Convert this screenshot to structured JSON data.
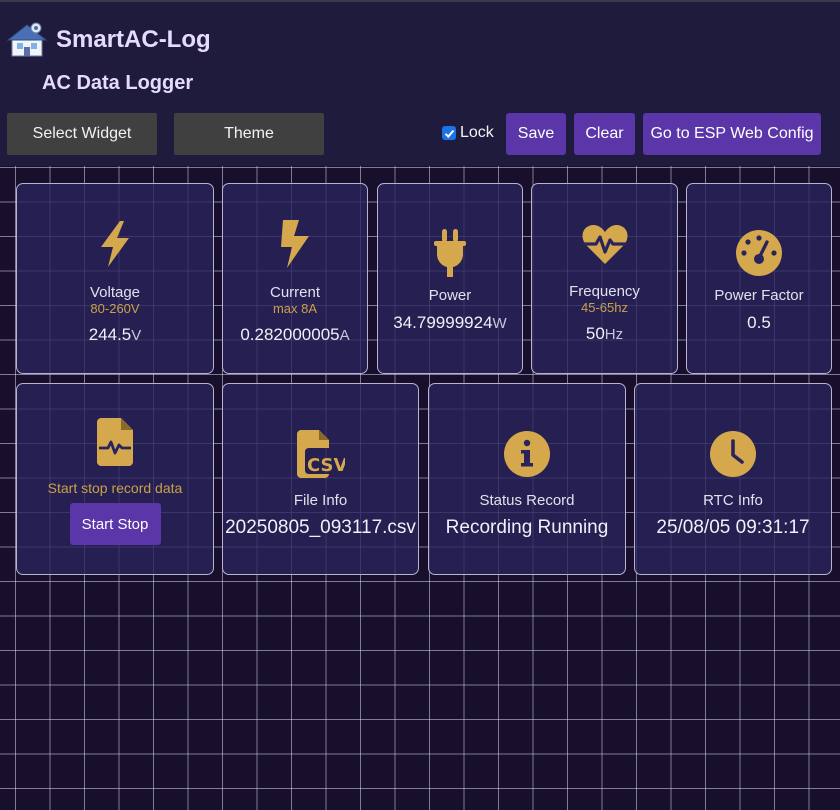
{
  "header": {
    "title": "SmartAC-Log",
    "subtitle": "AC Data Logger"
  },
  "toolbar": {
    "select_widget_label": "Select Widget",
    "theme_label": "Theme",
    "lock_label": "Lock",
    "lock_checked": true,
    "save_label": "Save",
    "clear_label": "Clear",
    "esp_config_label": "Go to ESP Web Config"
  },
  "colors": {
    "background": "#170f2c",
    "header_background": "#1f1b3d",
    "accent_purple": "#5b36a8",
    "icon_gold": "#d5a84e",
    "range_text": "#c9a04a"
  },
  "widgets": {
    "voltage": {
      "label": "Voltage",
      "range": "80-260V",
      "value": "244.5",
      "unit": "V",
      "icon": "bolt-icon"
    },
    "current": {
      "label": "Current",
      "range": "max 8A",
      "value": "0.282000005",
      "unit": "A",
      "icon": "bolt-icon"
    },
    "power": {
      "label": "Power",
      "value": "34.79999924",
      "unit": "W",
      "icon": "plug-icon"
    },
    "frequency": {
      "label": "Frequency",
      "range": "45-65hz",
      "value": "50",
      "unit": "Hz",
      "icon": "heart-pulse-icon"
    },
    "power_factor": {
      "label": "Power Factor",
      "value": "0.5",
      "icon": "gauge-icon"
    },
    "record": {
      "label": "Start stop record data",
      "button_label": "Start Stop",
      "icon": "file-waveform-icon"
    },
    "file_info": {
      "label": "File Info",
      "value": "20250805_093117.csv",
      "icon": "file-csv-icon"
    },
    "status_record": {
      "label": "Status Record",
      "value": "Recording Running",
      "icon": "info-circle-icon"
    },
    "rtc_info": {
      "label": "RTC Info",
      "value": "25/08/05 09:31:17",
      "icon": "clock-icon"
    }
  }
}
